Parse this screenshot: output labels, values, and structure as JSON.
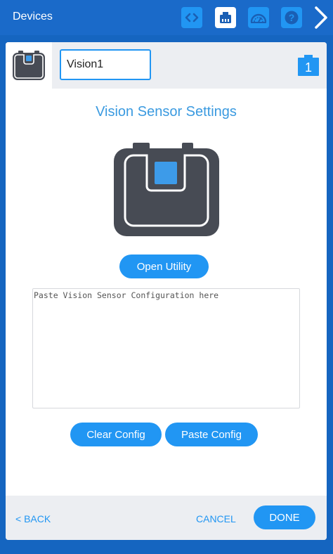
{
  "topbar": {
    "title": "Devices",
    "icons": [
      "code-icon",
      "device-icon",
      "dashboard-icon",
      "help-icon",
      "chevron-right-icon"
    ],
    "active": "device-icon"
  },
  "device": {
    "name": "Vision1",
    "port": "1"
  },
  "settings": {
    "title": "Vision Sensor Settings",
    "open_utility_label": "Open Utility",
    "config_placeholder": "Paste Vision Sensor Configuration here",
    "clear_label": "Clear Config",
    "paste_label": "Paste Config"
  },
  "footer": {
    "back_label": "< BACK",
    "cancel_label": "CANCEL",
    "done_label": "DONE"
  },
  "colors": {
    "accent": "#2196f3",
    "topbar": "#1a6ac9",
    "background": "#1565c0",
    "sensor_body": "#474b54",
    "title_text": "#3a9ae0"
  }
}
